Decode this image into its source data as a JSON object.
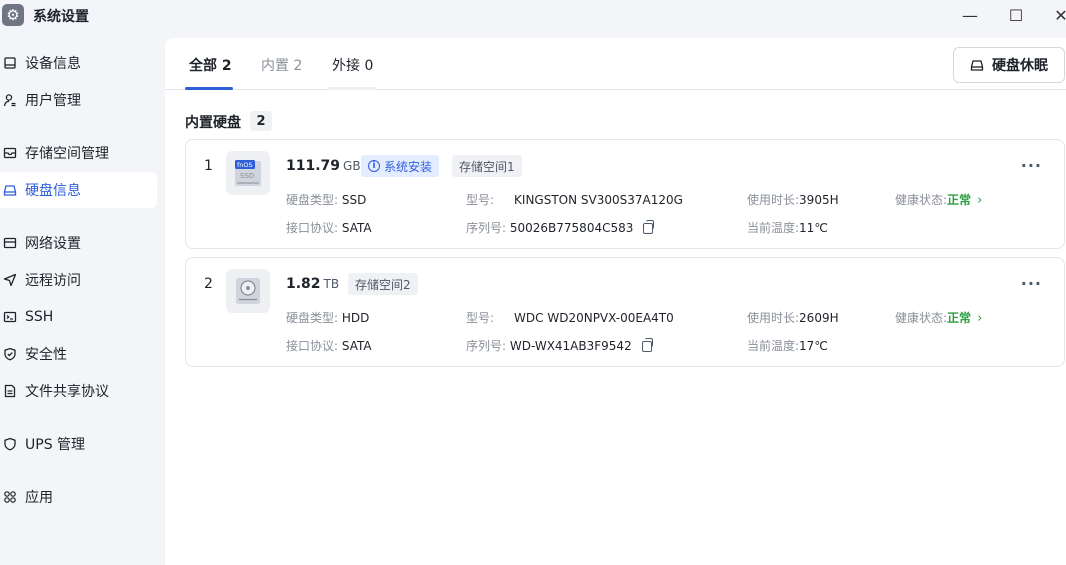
{
  "window": {
    "title": "系统设置",
    "minimize": "—",
    "maximize": "☐",
    "close": "✕"
  },
  "sidebar": {
    "items": [
      {
        "label": "设备信息",
        "icon": "device-icon"
      },
      {
        "label": "用户管理",
        "icon": "user-icon"
      },
      {
        "label": "存储空间管理",
        "icon": "storage-icon"
      },
      {
        "label": "硬盘信息",
        "icon": "disk-icon"
      },
      {
        "label": "网络设置",
        "icon": "network-icon"
      },
      {
        "label": "远程访问",
        "icon": "remote-icon"
      },
      {
        "label": "SSH",
        "icon": "ssh-icon"
      },
      {
        "label": "安全性",
        "icon": "shield-icon"
      },
      {
        "label": "文件共享协议",
        "icon": "file-share-icon"
      },
      {
        "label": "UPS 管理",
        "icon": "ups-icon"
      },
      {
        "label": "应用",
        "icon": "apps-icon"
      }
    ],
    "active_index": 3
  },
  "tabs": [
    {
      "label": "全部 2",
      "active": true
    },
    {
      "label": "内置 2",
      "active": false
    },
    {
      "label": "外接 0",
      "active": false
    }
  ],
  "sleep_button": "硬盘休眠",
  "section": {
    "title": "内置硬盘",
    "count": "2"
  },
  "labels": {
    "disk_type": "硬盘类型:",
    "interface": "接口协议:",
    "model": "型号:",
    "serial": "序列号:",
    "usage_time": "使用时长:",
    "temperature": "当前温度:",
    "health": "健康状态:"
  },
  "disks": [
    {
      "index": "1",
      "thumb_label": "fnOS",
      "thumb_sub": "SSD",
      "size": "111.79",
      "unit": "GB",
      "system_tag": "系统安装",
      "pool_tag": "存储空间1",
      "disk_type": "SSD",
      "interface": "SATA",
      "model": "KINGSTON SV300S37A120G",
      "serial": "50026B775804C583",
      "usage_time": "3905H",
      "temperature": "11℃",
      "health": "正常",
      "more": "···"
    },
    {
      "index": "2",
      "size": "1.82",
      "unit": "TB",
      "pool_tag": "存储空间2",
      "disk_type": "HDD",
      "interface": "SATA",
      "model": "WDC WD20NPVX-00EA4T0",
      "serial": "WD-WX41AB3F9542",
      "usage_time": "2609H",
      "temperature": "17℃",
      "health": "正常",
      "more": "···"
    }
  ],
  "colors": {
    "accent": "#2f5fd8",
    "health_ok": "#2f9e44",
    "sidebar_bg": "#f4f5f9"
  }
}
